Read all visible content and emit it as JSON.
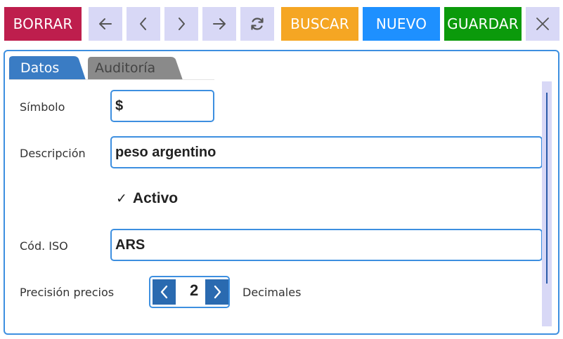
{
  "toolbar": {
    "borrar_label": "BORRAR",
    "buscar_label": "BUSCAR",
    "nuevo_label": "NUEVO",
    "guardar_label": "GUARDAR",
    "icons": [
      "arrow-left-icon",
      "chevron-left-icon",
      "chevron-right-icon",
      "arrow-right-icon",
      "refresh-icon",
      "close-icon"
    ]
  },
  "colors": {
    "borrar": "#be1e4d",
    "buscar": "#f5a623",
    "nuevo": "#1e90ff",
    "guardar": "#0b9a0b",
    "icon_button": "#d8d8f6",
    "accent": "#3d8fe0",
    "tab_active": "#3a7cc4",
    "tab_inactive": "#8a8a8a",
    "stepper": "#2a6ab0"
  },
  "tabs": [
    {
      "label": "Datos",
      "active": true
    },
    {
      "label": "Auditoría",
      "active": false
    }
  ],
  "form": {
    "simbolo": {
      "label": "Símbolo",
      "value": "$"
    },
    "descripcion": {
      "label": "Descripción",
      "value": "peso argentino"
    },
    "activo": {
      "label": "Activo",
      "checked": true,
      "mark": "✓"
    },
    "iso": {
      "label": "Cód. ISO",
      "value": "ARS"
    },
    "precision": {
      "label": "Precisión precios",
      "value": "2",
      "suffix": "Decimales"
    }
  }
}
